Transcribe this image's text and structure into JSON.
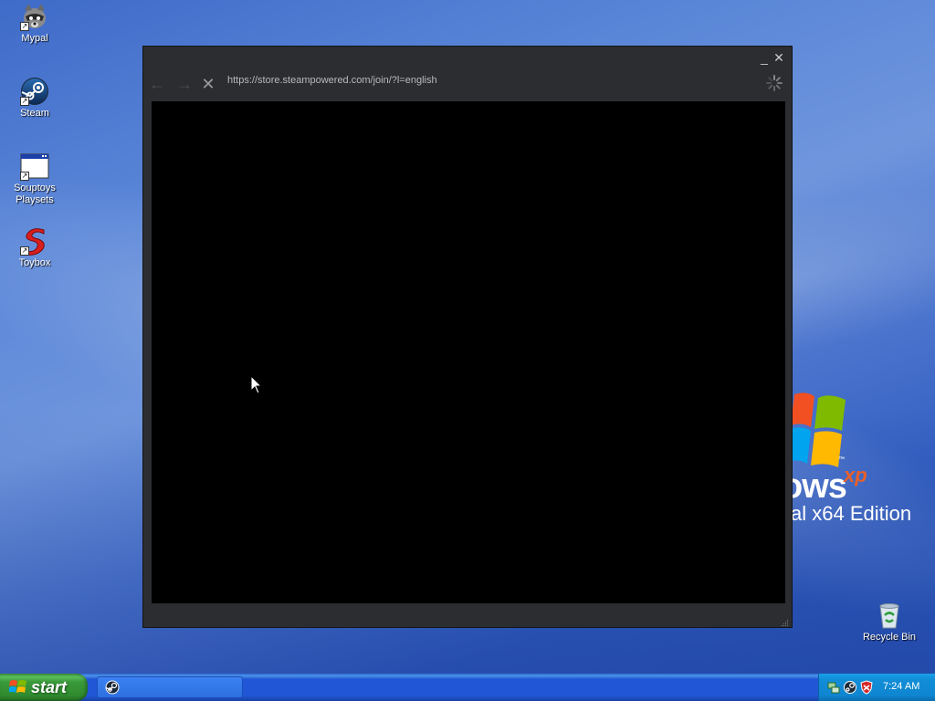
{
  "desktop": {
    "icons": [
      {
        "label": "Mypal",
        "icon": "raccoon-icon"
      },
      {
        "label": "Steam",
        "icon": "steam-icon"
      },
      {
        "label": "Souptoys Playsets",
        "icon": "window-app-icon"
      },
      {
        "label": "Toybox",
        "icon": "toybox-s-icon"
      },
      {
        "label": "Recycle Bin",
        "icon": "recycle-bin-icon"
      }
    ],
    "wallpaper": {
      "brand_text": "ows",
      "brand_sup": "xp",
      "edition_text": "al x64 Edition"
    }
  },
  "browser_window": {
    "url": "https://store.steampowered.com/join/?l=english",
    "minimize_glyph": "_",
    "close_glyph": "✕",
    "back_glyph": "←",
    "forward_glyph": "→",
    "stop_glyph": "✕",
    "content_color": "#000000"
  },
  "taskbar": {
    "start_label": "start",
    "clock": "7:24 AM",
    "tray_icons": [
      "network-icon",
      "steam-tray-icon",
      "security-shield-icon"
    ]
  },
  "colors": {
    "steam_chrome": "#2b2d31",
    "taskbar_blue": "#2157d7",
    "start_green": "#3a9a3a",
    "tray_blue": "#0f85d0"
  }
}
